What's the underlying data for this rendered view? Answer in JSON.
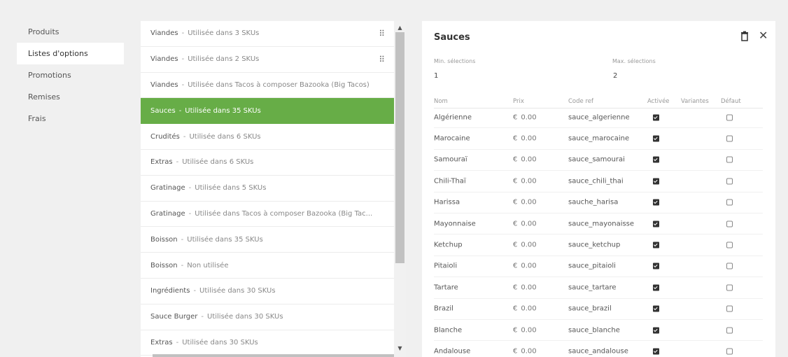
{
  "nav": {
    "items": [
      {
        "label": "Produits",
        "active": false
      },
      {
        "label": "Listes d'options",
        "active": true
      },
      {
        "label": "Promotions",
        "active": false
      },
      {
        "label": "Remises",
        "active": false
      },
      {
        "label": "Frais",
        "active": false
      }
    ]
  },
  "option_lists": [
    {
      "name": "Viandes",
      "usage": "Utilisée dans 3 SKUs",
      "draggable": true,
      "active": false
    },
    {
      "name": "Viandes",
      "usage": "Utilisée dans 2 SKUs",
      "draggable": true,
      "active": false
    },
    {
      "name": "Viandes",
      "usage": "Utilisée dans Tacos à composer Bazooka (Big Tacos)",
      "draggable": false,
      "active": false
    },
    {
      "name": "Sauces",
      "usage": "Utilisée dans 35 SKUs",
      "draggable": false,
      "active": true
    },
    {
      "name": "Crudités",
      "usage": "Utilisée dans 6 SKUs",
      "draggable": false,
      "active": false
    },
    {
      "name": "Extras",
      "usage": "Utilisée dans 6 SKUs",
      "draggable": false,
      "active": false
    },
    {
      "name": "Gratinage",
      "usage": "Utilisée dans 5 SKUs",
      "draggable": false,
      "active": false
    },
    {
      "name": "Gratinage",
      "usage": "Utilisée dans Tacos à composer Bazooka (Big Tac...",
      "draggable": false,
      "active": false
    },
    {
      "name": "Boisson",
      "usage": "Utilisée dans 35 SKUs",
      "draggable": false,
      "active": false
    },
    {
      "name": "Boisson",
      "usage": "Non utilisée",
      "draggable": false,
      "active": false
    },
    {
      "name": "Ingrédients",
      "usage": "Utilisée dans 30 SKUs",
      "draggable": false,
      "active": false
    },
    {
      "name": "Sauce Burger",
      "usage": "Utilisée dans 30 SKUs",
      "draggable": false,
      "active": false
    },
    {
      "name": "Extras",
      "usage": "Utilisée dans 30 SKUs",
      "draggable": false,
      "active": false
    }
  ],
  "list_separator": "-",
  "panel": {
    "title": "Sauces",
    "min_label": "Min. sélections",
    "min_value": "1",
    "max_label": "Max. sélections",
    "max_value": "2",
    "columns": {
      "name": "Nom",
      "price": "Prix",
      "code": "Code ref",
      "enabled": "Activée",
      "variants": "Variantes",
      "default": "Défaut"
    },
    "currency": "€",
    "rows": [
      {
        "name": "Algérienne",
        "price": "0.00",
        "code": "sauce_algerienne",
        "enabled": true,
        "default": false
      },
      {
        "name": "Marocaine",
        "price": "0.00",
        "code": "sauce_marocaine",
        "enabled": true,
        "default": false
      },
      {
        "name": "Samouraï",
        "price": "0.00",
        "code": "sauce_samourai",
        "enabled": true,
        "default": false
      },
      {
        "name": "Chili-Thaï",
        "price": "0.00",
        "code": "sauce_chili_thai",
        "enabled": true,
        "default": false
      },
      {
        "name": "Harissa",
        "price": "0.00",
        "code": "sauche_harisa",
        "enabled": true,
        "default": false
      },
      {
        "name": "Mayonnaise",
        "price": "0.00",
        "code": "sauce_mayonaisse",
        "enabled": true,
        "default": false
      },
      {
        "name": "Ketchup",
        "price": "0.00",
        "code": "sauce_ketchup",
        "enabled": true,
        "default": false
      },
      {
        "name": "Pitaioli",
        "price": "0.00",
        "code": "sauce_pitaioli",
        "enabled": true,
        "default": false
      },
      {
        "name": "Tartare",
        "price": "0.00",
        "code": "sauce_tartare",
        "enabled": true,
        "default": false
      },
      {
        "name": "Brazil",
        "price": "0.00",
        "code": "sauce_brazil",
        "enabled": true,
        "default": false
      },
      {
        "name": "Blanche",
        "price": "0.00",
        "code": "sauce_blanche",
        "enabled": true,
        "default": false
      },
      {
        "name": "Andalouse",
        "price": "0.00",
        "code": "sauce_andalouse",
        "enabled": true,
        "default": false
      }
    ]
  },
  "colors": {
    "accent": "#67ad47",
    "background": "#f0f0f0"
  },
  "icons": {
    "drag": "drag-handle-icon",
    "trash": "trash-icon",
    "close": "close-icon"
  }
}
